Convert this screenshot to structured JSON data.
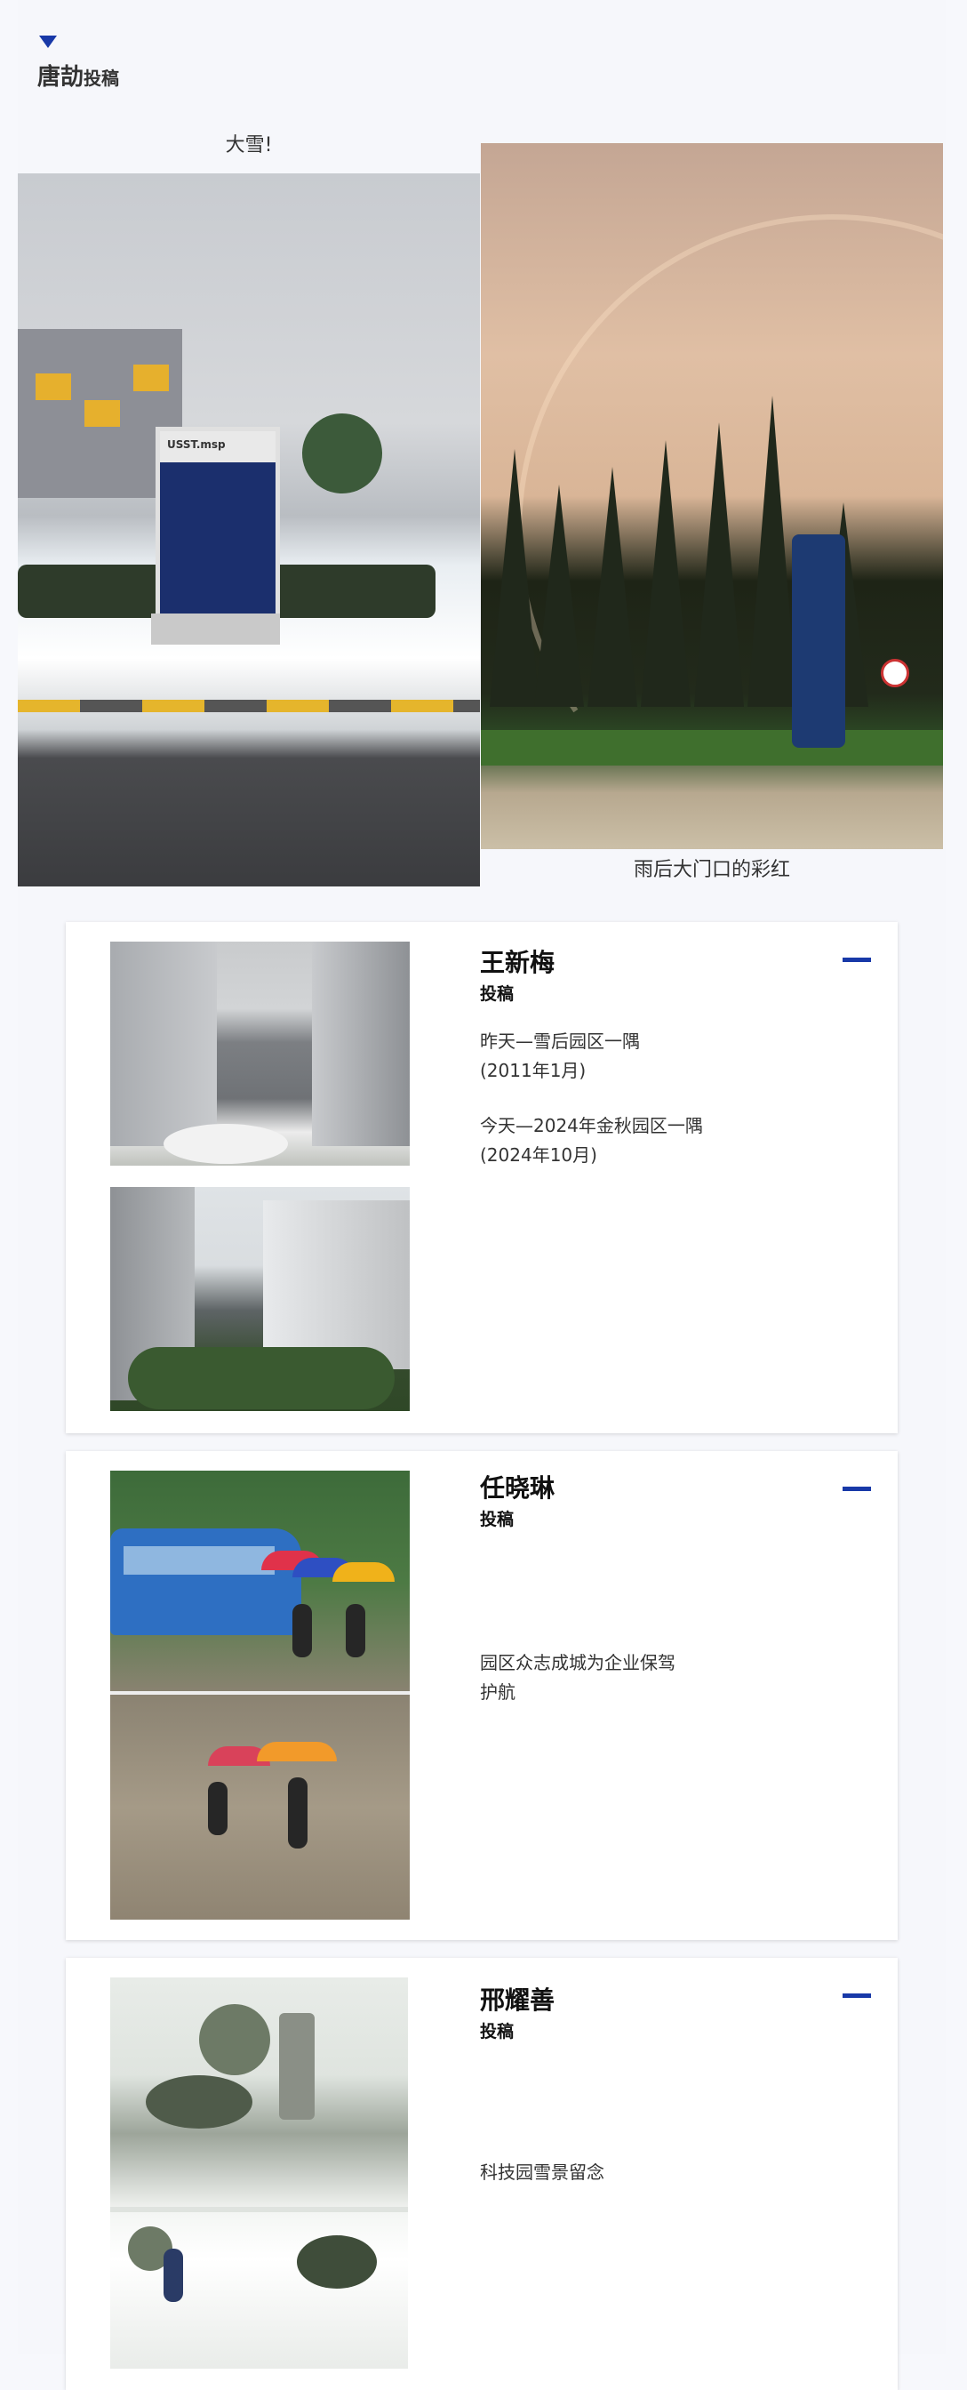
{
  "top": {
    "author": "唐劼",
    "tag": "投稿",
    "caption_left": "大雪!",
    "caption_right": "雨后大门口的彩红",
    "sign_text": "USST.msp"
  },
  "cards": [
    {
      "name": "王新梅",
      "tag": "投稿",
      "lines": [
        "昨天—雪后园区一隅",
        "(2011年1月)",
        "",
        "今天—2024年金秋园区一隅",
        "(2024年10月)"
      ]
    },
    {
      "name": "任晓琳",
      "tag": "投稿",
      "lines": [
        "园区众志成城为企业保驾",
        "护航"
      ]
    },
    {
      "name": "邢耀善",
      "tag": "投稿",
      "lines": [
        "科技园雪景留念"
      ]
    }
  ],
  "colors": {
    "accent": "#1839a8",
    "background": "#f7f8fc"
  },
  "icons": {
    "collapse": "triangle-down-icon",
    "card_marker": "dash-icon"
  }
}
